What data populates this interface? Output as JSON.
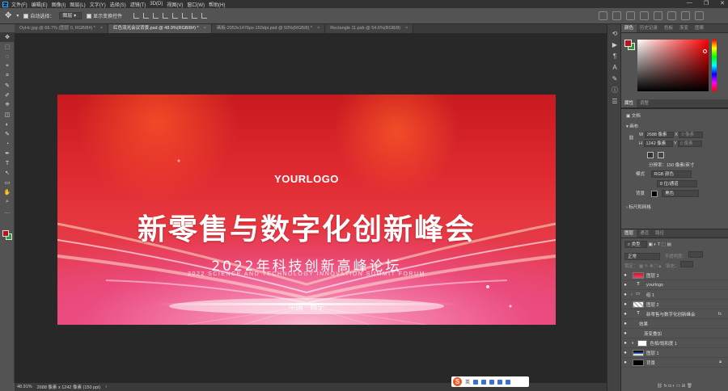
{
  "app": {
    "logo": "Ps"
  },
  "menu": [
    "文件(F)",
    "编辑(E)",
    "图像(I)",
    "图层(L)",
    "文字(Y)",
    "选择(S)",
    "滤镜(T)",
    "3D(D)",
    "视图(V)",
    "窗口(W)",
    "帮助(H)"
  ],
  "window_controls": [
    "—",
    "❐",
    "✕"
  ],
  "options": {
    "auto_select_label": "自动选择：",
    "auto_select_value": "图层",
    "show_transform_label": "显示变换控件"
  },
  "tabs": [
    {
      "label": "OyHc.jpg @ 66.7% (图层 0, RGB/8#) *",
      "active": false
    },
    {
      "label": "红色流光会议背景.psd @ 48.9%(RGB/8#) *",
      "active": true
    },
    {
      "label": "画板-2953x1476px-150dpi.psd @ 50%(RGB/8) *",
      "active": false
    },
    {
      "label": "Rectangle 11.psb @ 54.6%(RGB/8)",
      "active": false
    }
  ],
  "tools": [
    "✥",
    "⬚",
    "◌",
    "⌖",
    "⌗",
    "✎",
    "✐",
    "⎈",
    "◫",
    "◐",
    "✎",
    "◔",
    "✒",
    "T",
    "↖",
    "▭",
    "✋",
    "⌕",
    "…"
  ],
  "canvas": {
    "logo": "YOURLOGO",
    "title": "新零售与数字化创新峰会",
    "subtitle": "2022年科技创新高峰论坛",
    "subtitle_en": "2022 SCIENCE AND TECHNOLOGY INNOVATION SUMMIT FORUM",
    "place": "中国 · 西宁"
  },
  "status": {
    "zoom": "48.91%",
    "doc_size": "2688 像素 x 1242 像素 (150 ppi)"
  },
  "ime": {
    "logo": "S",
    "lang": "英"
  },
  "panels": {
    "color_tabs": [
      "颜色",
      "历史记录",
      "色板",
      "渐变",
      "图案"
    ],
    "properties_tabs": [
      "属性",
      "调整"
    ],
    "properties": {
      "doc_label": "文档",
      "canvas_label": "画布",
      "w_label": "W",
      "w_value": "2688 像素",
      "x_label": "X",
      "x_value": "0 像素",
      "h_label": "H",
      "h_value": "1242 像素",
      "y_label": "Y",
      "y_value": "0 像素",
      "resolution": "分辨率：150 像素/英寸",
      "mode_label": "模式",
      "mode_value": "RGB 颜色",
      "depth_value": "8 位/通道",
      "bg_label": "背景",
      "bg_value": "黑色",
      "rulers_label": "标尺和网格"
    },
    "layers_tabs": [
      "图层",
      "通道",
      "路径"
    ],
    "layers_filter": "类型",
    "layers_blend": "正常",
    "layers_opacity": "不透明度：",
    "layers_lock": "锁定：",
    "layers_fill": "填充：",
    "layers": [
      {
        "name": "图层 3",
        "type": "pixel"
      },
      {
        "name": "yourlogo",
        "type": "text"
      },
      {
        "name": "组 1",
        "type": "group"
      },
      {
        "name": "图层 2",
        "type": "pixel"
      },
      {
        "name": "新零售与数字化创新峰会",
        "type": "text"
      },
      {
        "name": "效果",
        "type": "effect"
      },
      {
        "name": "渐变叠加",
        "type": "effect-item"
      },
      {
        "name": "色相/饱和度 1",
        "type": "adjustment"
      },
      {
        "name": "图层 1",
        "type": "pixel"
      },
      {
        "name": "背景",
        "type": "background"
      }
    ]
  }
}
